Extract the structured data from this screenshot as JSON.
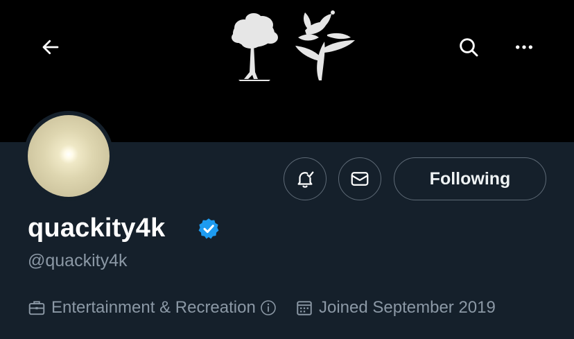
{
  "colors": {
    "banner": "#000000",
    "background": "#15202b",
    "text_primary": "#ffffff",
    "text_secondary": "#8b98a5",
    "border": "#5f6b77",
    "verified": "#1d9bf0"
  },
  "header": {
    "back_icon": "back-arrow-icon",
    "search_icon": "search-icon",
    "more_icon": "more-dots-icon"
  },
  "actions": {
    "notify_icon": "bell-check-icon",
    "message_icon": "envelope-icon",
    "following_label": "Following"
  },
  "profile": {
    "display_name": "quackity4k",
    "handle": "@quackity4k",
    "verified": true,
    "category": "Entertainment & Recreation",
    "joined": "Joined September 2019"
  }
}
